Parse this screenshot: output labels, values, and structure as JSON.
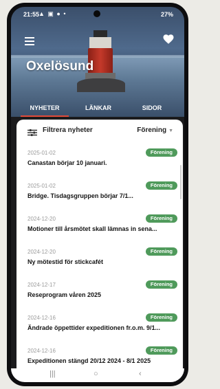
{
  "status": {
    "time": "21:55",
    "icons": "▲ ▣ ● •",
    "battery": "27%"
  },
  "app": {
    "title": "Oxelösund"
  },
  "tabs": [
    {
      "label": "NYHETER",
      "active": true
    },
    {
      "label": "LÄNKAR",
      "active": false
    },
    {
      "label": "SIDOR",
      "active": false
    }
  ],
  "filter": {
    "label": "Filtrera nyheter",
    "selected": "Förening"
  },
  "news": [
    {
      "date": "2025-01-02",
      "tag": "Förening",
      "title": "Canastan börjar 10 januari."
    },
    {
      "date": "2025-01-02",
      "tag": "Förening",
      "title": "Bridge. Tisdagsgruppen börjar 7/1..."
    },
    {
      "date": "2024-12-20",
      "tag": "Förening",
      "title": "Motioner till årsmötet skall lämnas in sena..."
    },
    {
      "date": "2024-12-20",
      "tag": "Förening",
      "title": "Ny mötestid för stickcafét"
    },
    {
      "date": "2024-12-17",
      "tag": "Förening",
      "title": "Reseprogram våren 2025"
    },
    {
      "date": "2024-12-16",
      "tag": "Förening",
      "title": "Ändrade öppettider expeditionen fr.o.m. 9/1..."
    },
    {
      "date": "2024-12-16",
      "tag": "Förening",
      "title": "Expeditionen stängd 20/12 2024 - 8/1 2025"
    }
  ],
  "navbar": {
    "recent": "|||",
    "home": "○",
    "back": "‹"
  },
  "colors": {
    "accent_underline": "#e34b3a",
    "badge": "#4f9a5b"
  }
}
